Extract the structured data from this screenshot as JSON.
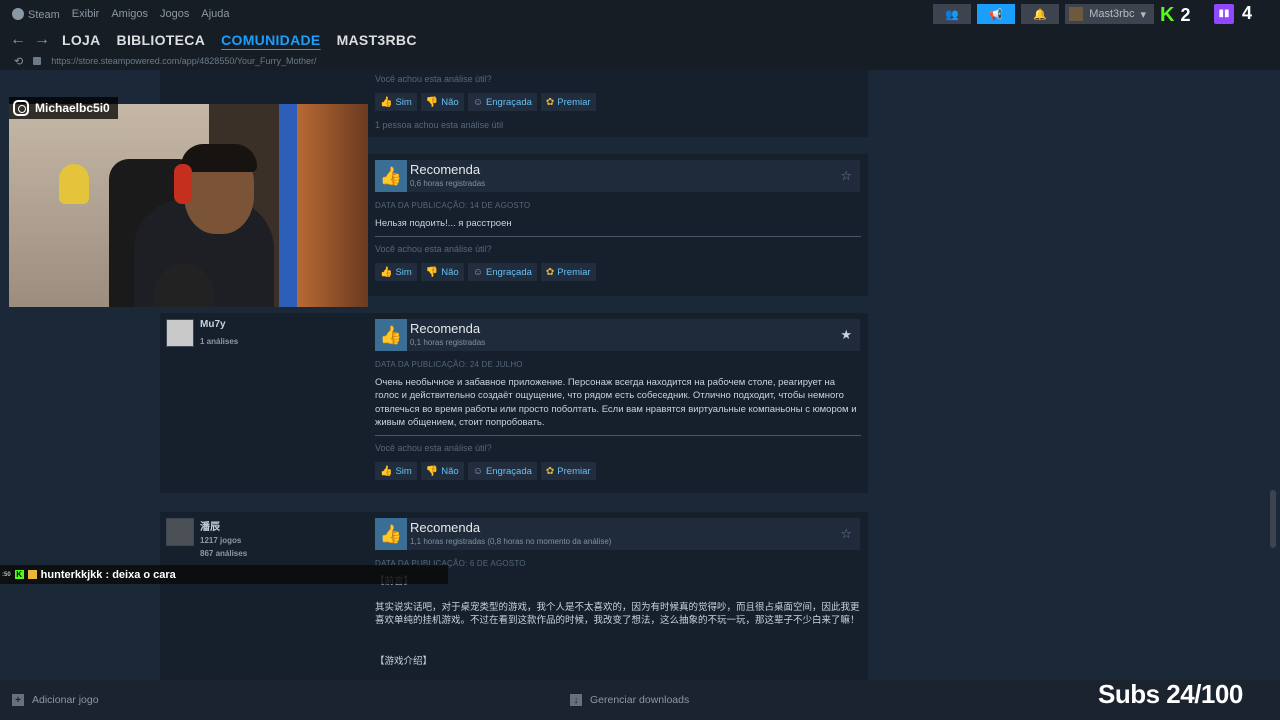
{
  "titlebar": {
    "app": "Steam",
    "menu": [
      "Exibir",
      "Amigos",
      "Jogos",
      "Ajuda"
    ],
    "username": "Mast3rbc"
  },
  "nav": {
    "tabs": [
      {
        "label": "LOJA",
        "active": false
      },
      {
        "label": "BIBLIOTECA",
        "active": false
      },
      {
        "label": "COMUNIDADE",
        "active": true
      },
      {
        "label": "MAST3RBC",
        "active": false
      }
    ]
  },
  "url": "https://store.steampowered.com/app/4828550/Your_Furry_Mother/",
  "vote_labels": {
    "question": "Você achou esta análise útil?",
    "yes": "Sim",
    "no": "Não",
    "funny": "Engraçada",
    "award": "Premiar"
  },
  "reviews": [
    {
      "found_helpful": "1 pessoa achou esta análise útil"
    },
    {
      "recommend": "Recomenda",
      "hours": "0,6 horas registradas",
      "date": "DATA DA PUBLICAÇÃO: 14 DE AGOSTO",
      "text": "Нельзя подоить!... я расстроен"
    },
    {
      "author": "Mu7y",
      "author_stats": [
        "1 análises"
      ],
      "recommend": "Recomenda",
      "hours": "0,1 horas registradas",
      "date": "DATA DA PUBLICAÇÃO: 24 DE JULHO",
      "text": "Очень необычное и забавное приложение. Персонаж всегда находится на рабочем столе, реагирует на голос и действительно создаёт ощущение, что рядом есть собеседник. Отлично подходит, чтобы немного отвлечься во время работы или просто поболтать. Если вам нравятся виртуальные компаньоны с юмором и живым общением, стоит попробовать."
    },
    {
      "author": "潘辰",
      "author_stats": [
        "1217 jogos",
        "867 análises"
      ],
      "recommend": "Recomenda",
      "hours": "1,1 horas registradas (0,8 horas no momento da análise)",
      "date": "DATA DA PUBLICAÇÃO: 6 DE AGOSTO",
      "text_lines": [
        "【前言】",
        "其实说实话吧，对于桌宠类型的游戏，我个人是不太喜欢的，因为有时候真的觉得吵，而且很占桌面空间，因此我更喜欢单纯的挂机游戏。不过在看到这款作品的时候，我改变了想法，这么抽象的不玩一玩，那这辈子不少白来了嘛！",
        "【游戏介绍】"
      ]
    }
  ],
  "bottombar": {
    "add_game": "Adicionar jogo",
    "manage_downloads": "Gerenciar downloads"
  },
  "overlay": {
    "instagram_handle": "Michaelbc5i0",
    "chat_user": "hunterkkjkk",
    "chat_text": "hunterkkjkk : deixa o cara",
    "kick_viewers": "2",
    "twitch_viewers": "4",
    "subs": "Subs 24/100"
  },
  "colors": {
    "accent": "#1a9fff",
    "link": "#66c0f4",
    "background": "#1b2838",
    "kick": "#53fc18",
    "twitch": "#9146ff"
  },
  "icons": [
    "steam-logo-icon",
    "back-arrow-icon",
    "forward-arrow-icon",
    "thumbs-up-icon",
    "thumbs-down-icon",
    "smiley-icon",
    "award-icon",
    "star-icon",
    "lock-icon",
    "plus-icon",
    "download-icon",
    "instagram-icon",
    "kick-icon",
    "twitch-icon",
    "bell-icon",
    "friends-icon",
    "megaphone-icon"
  ]
}
